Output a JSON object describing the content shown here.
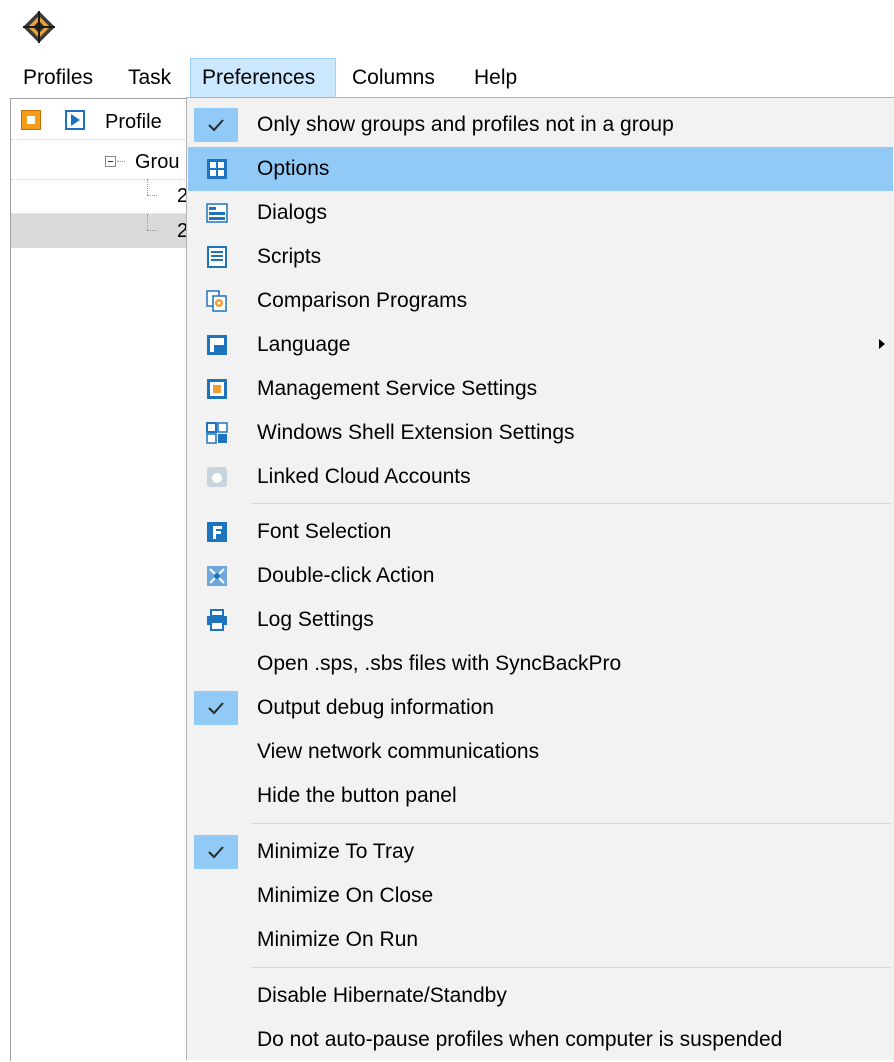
{
  "menubar": {
    "items": [
      "Profiles",
      "Task",
      "Preferences",
      "Columns",
      "Help"
    ],
    "active": "Preferences"
  },
  "tree": {
    "profile_label": "Profile",
    "group_label": "Grou",
    "child1": "2",
    "child2": "2"
  },
  "menu": {
    "items": [
      {
        "label": "Only show groups and profiles not in a group",
        "checked": true
      },
      {
        "label": "Options",
        "icon": "options-icon",
        "highlighted": true
      },
      {
        "label": "Dialogs",
        "icon": "dialogs-icon"
      },
      {
        "label": "Scripts",
        "icon": "scripts-icon"
      },
      {
        "label": "Comparison Programs",
        "icon": "comparison-programs-icon"
      },
      {
        "label": "Language",
        "icon": "language-icon",
        "submenu": true
      },
      {
        "label": "Management Service Settings",
        "icon": "management-service-icon"
      },
      {
        "label": "Windows Shell Extension Settings",
        "icon": "shell-extension-icon"
      },
      {
        "label": "Linked Cloud Accounts",
        "icon": "cloud-accounts-icon"
      },
      {
        "label": "Font Selection",
        "icon": "font-icon"
      },
      {
        "label": "Double-click Action",
        "icon": "double-click-icon"
      },
      {
        "label": "Log Settings",
        "icon": "log-settings-icon"
      },
      {
        "label": "Open .sps, .sbs files with SyncBackPro"
      },
      {
        "label": "Output debug information",
        "checked": true
      },
      {
        "label": "View network communications"
      },
      {
        "label": "Hide the button panel"
      },
      {
        "label": "Minimize To Tray",
        "checked": true
      },
      {
        "label": "Minimize On Close"
      },
      {
        "label": "Minimize On Run"
      },
      {
        "label": "Disable Hibernate/Standby"
      },
      {
        "label": "Do not auto-pause profiles when computer is suspended"
      }
    ]
  },
  "colors": {
    "highlight": "#91c9f7",
    "menu_bg": "#f2f2f2",
    "menubar_active": "#cce8ff",
    "icon_blue": "#1e73be",
    "icon_orange": "#f0a030"
  }
}
